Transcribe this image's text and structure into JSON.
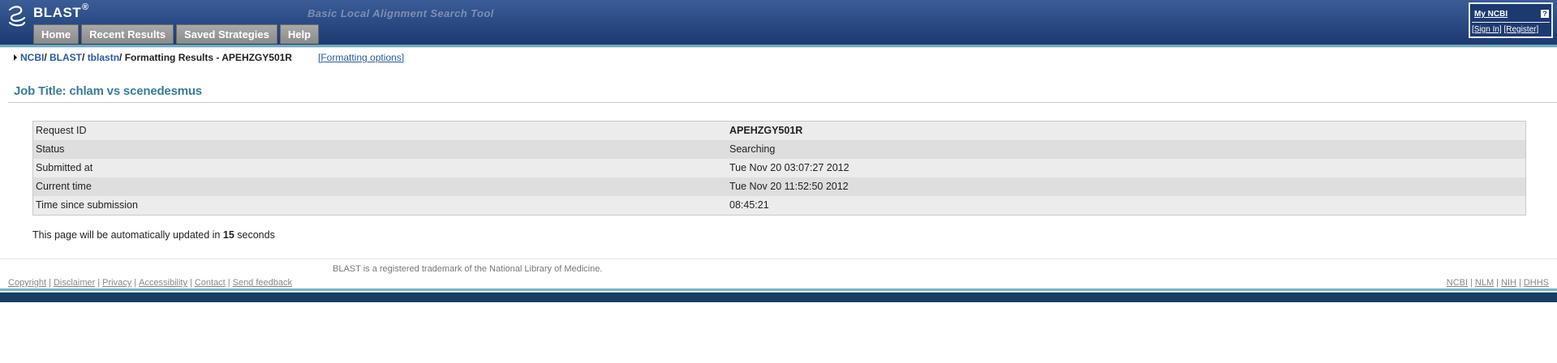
{
  "header": {
    "logo_text": "BLAST",
    "logo_mark": "®",
    "tagline": "Basic Local Alignment Search Tool",
    "nav": [
      {
        "label": "Home"
      },
      {
        "label": "Recent Results"
      },
      {
        "label": "Saved Strategies"
      },
      {
        "label": "Help"
      }
    ],
    "my_ncbi": {
      "label": "My NCBI",
      "help": "?",
      "sign_in": "[Sign In]",
      "register": "[Register]"
    }
  },
  "breadcrumb": {
    "items": [
      "NCBI",
      "BLAST",
      "tblastn"
    ],
    "current": "Formatting Results - APEHZGY501R",
    "formatting_options": "[Formatting options]"
  },
  "job": {
    "title": "Job Title: chlam vs scenedesmus"
  },
  "status_table": {
    "rows": [
      {
        "label": "Request ID",
        "value": "APEHZGY501R"
      },
      {
        "label": "Status",
        "value": "Searching"
      },
      {
        "label": "Submitted at",
        "value": "Tue Nov 20 03:07:27 2012"
      },
      {
        "label": "Current time",
        "value": "Tue Nov 20 11:52:50 2012"
      },
      {
        "label": "Time since submission",
        "value": "08:45:21"
      }
    ]
  },
  "update": {
    "prefix": "This page will be automatically updated in",
    "seconds": "15",
    "suffix": "seconds"
  },
  "footer": {
    "trademark": "BLAST is a registered trademark of the National Library of Medicine.",
    "left_links": [
      "Copyright",
      "Disclaimer",
      "Privacy",
      "Accessibility",
      "Contact",
      "Send feedback"
    ],
    "right_links": [
      "NCBI",
      "NLM",
      "NIH",
      "DHHS"
    ]
  },
  "colors": {
    "header_blue": "#2c4c86",
    "link_blue": "#2a5aa0",
    "title_teal": "#3b7a9a",
    "nav_gray": "#8a8a8a"
  }
}
